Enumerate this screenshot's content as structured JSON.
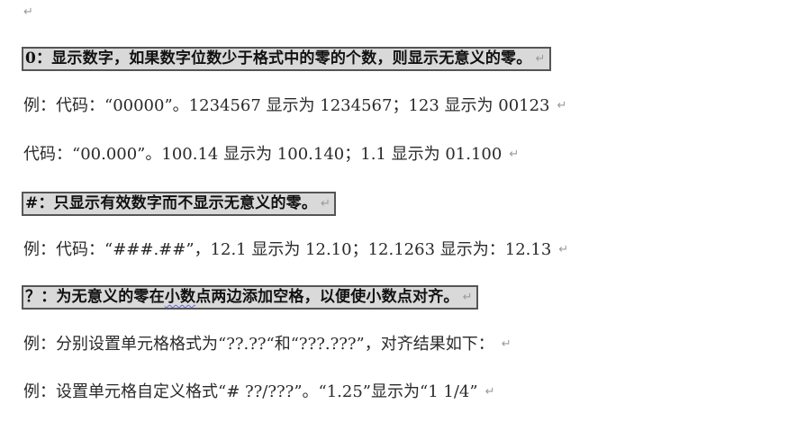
{
  "paragraph_mark": "↵",
  "lines": [
    {
      "type": "heading",
      "text": "0：显示数字，如果数字位数少于格式中的零的个数，则显示无意义的零。"
    },
    {
      "type": "text",
      "text": "例：代码：“00000”。1234567 显示为 1234567；123 显示为 00123"
    },
    {
      "type": "text",
      "text": "代码：“00.000”。100.14 显示为 100.140；1.1 显示为 01.100"
    },
    {
      "type": "heading",
      "text": "#：只显示有效数字而不显示无意义的零。"
    },
    {
      "type": "text",
      "text": "例：代码：“###.##”，12.1 显示为 12.10；12.1263 显示为：12.13"
    },
    {
      "type": "heading",
      "text_before": "？：为无意义的零在",
      "text_squiggle": "小数",
      "text_after": "点两边添加空格，以便使小数点对齐。"
    },
    {
      "type": "text",
      "text": "例：分别设置单元格格式为“??.??“和“???.???”，对齐结果如下："
    },
    {
      "type": "text",
      "text": "例：设置单元格自定义格式“# ??/???”。“1.25”显示为“1 1/4”"
    }
  ]
}
